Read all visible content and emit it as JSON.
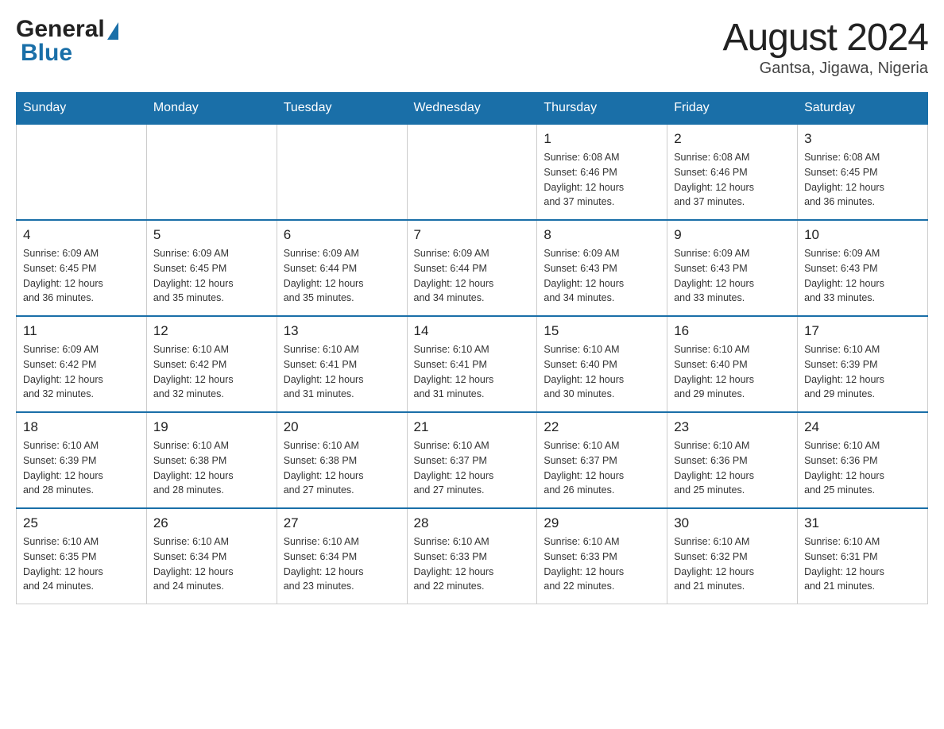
{
  "header": {
    "logo_general": "General",
    "logo_blue": "Blue",
    "title": "August 2024",
    "subtitle": "Gantsa, Jigawa, Nigeria"
  },
  "weekdays": [
    "Sunday",
    "Monday",
    "Tuesday",
    "Wednesday",
    "Thursday",
    "Friday",
    "Saturday"
  ],
  "weeks": [
    [
      {
        "day": "",
        "info": ""
      },
      {
        "day": "",
        "info": ""
      },
      {
        "day": "",
        "info": ""
      },
      {
        "day": "",
        "info": ""
      },
      {
        "day": "1",
        "info": "Sunrise: 6:08 AM\nSunset: 6:46 PM\nDaylight: 12 hours\nand 37 minutes."
      },
      {
        "day": "2",
        "info": "Sunrise: 6:08 AM\nSunset: 6:46 PM\nDaylight: 12 hours\nand 37 minutes."
      },
      {
        "day": "3",
        "info": "Sunrise: 6:08 AM\nSunset: 6:45 PM\nDaylight: 12 hours\nand 36 minutes."
      }
    ],
    [
      {
        "day": "4",
        "info": "Sunrise: 6:09 AM\nSunset: 6:45 PM\nDaylight: 12 hours\nand 36 minutes."
      },
      {
        "day": "5",
        "info": "Sunrise: 6:09 AM\nSunset: 6:45 PM\nDaylight: 12 hours\nand 35 minutes."
      },
      {
        "day": "6",
        "info": "Sunrise: 6:09 AM\nSunset: 6:44 PM\nDaylight: 12 hours\nand 35 minutes."
      },
      {
        "day": "7",
        "info": "Sunrise: 6:09 AM\nSunset: 6:44 PM\nDaylight: 12 hours\nand 34 minutes."
      },
      {
        "day": "8",
        "info": "Sunrise: 6:09 AM\nSunset: 6:43 PM\nDaylight: 12 hours\nand 34 minutes."
      },
      {
        "day": "9",
        "info": "Sunrise: 6:09 AM\nSunset: 6:43 PM\nDaylight: 12 hours\nand 33 minutes."
      },
      {
        "day": "10",
        "info": "Sunrise: 6:09 AM\nSunset: 6:43 PM\nDaylight: 12 hours\nand 33 minutes."
      }
    ],
    [
      {
        "day": "11",
        "info": "Sunrise: 6:09 AM\nSunset: 6:42 PM\nDaylight: 12 hours\nand 32 minutes."
      },
      {
        "day": "12",
        "info": "Sunrise: 6:10 AM\nSunset: 6:42 PM\nDaylight: 12 hours\nand 32 minutes."
      },
      {
        "day": "13",
        "info": "Sunrise: 6:10 AM\nSunset: 6:41 PM\nDaylight: 12 hours\nand 31 minutes."
      },
      {
        "day": "14",
        "info": "Sunrise: 6:10 AM\nSunset: 6:41 PM\nDaylight: 12 hours\nand 31 minutes."
      },
      {
        "day": "15",
        "info": "Sunrise: 6:10 AM\nSunset: 6:40 PM\nDaylight: 12 hours\nand 30 minutes."
      },
      {
        "day": "16",
        "info": "Sunrise: 6:10 AM\nSunset: 6:40 PM\nDaylight: 12 hours\nand 29 minutes."
      },
      {
        "day": "17",
        "info": "Sunrise: 6:10 AM\nSunset: 6:39 PM\nDaylight: 12 hours\nand 29 minutes."
      }
    ],
    [
      {
        "day": "18",
        "info": "Sunrise: 6:10 AM\nSunset: 6:39 PM\nDaylight: 12 hours\nand 28 minutes."
      },
      {
        "day": "19",
        "info": "Sunrise: 6:10 AM\nSunset: 6:38 PM\nDaylight: 12 hours\nand 28 minutes."
      },
      {
        "day": "20",
        "info": "Sunrise: 6:10 AM\nSunset: 6:38 PM\nDaylight: 12 hours\nand 27 minutes."
      },
      {
        "day": "21",
        "info": "Sunrise: 6:10 AM\nSunset: 6:37 PM\nDaylight: 12 hours\nand 27 minutes."
      },
      {
        "day": "22",
        "info": "Sunrise: 6:10 AM\nSunset: 6:37 PM\nDaylight: 12 hours\nand 26 minutes."
      },
      {
        "day": "23",
        "info": "Sunrise: 6:10 AM\nSunset: 6:36 PM\nDaylight: 12 hours\nand 25 minutes."
      },
      {
        "day": "24",
        "info": "Sunrise: 6:10 AM\nSunset: 6:36 PM\nDaylight: 12 hours\nand 25 minutes."
      }
    ],
    [
      {
        "day": "25",
        "info": "Sunrise: 6:10 AM\nSunset: 6:35 PM\nDaylight: 12 hours\nand 24 minutes."
      },
      {
        "day": "26",
        "info": "Sunrise: 6:10 AM\nSunset: 6:34 PM\nDaylight: 12 hours\nand 24 minutes."
      },
      {
        "day": "27",
        "info": "Sunrise: 6:10 AM\nSunset: 6:34 PM\nDaylight: 12 hours\nand 23 minutes."
      },
      {
        "day": "28",
        "info": "Sunrise: 6:10 AM\nSunset: 6:33 PM\nDaylight: 12 hours\nand 22 minutes."
      },
      {
        "day": "29",
        "info": "Sunrise: 6:10 AM\nSunset: 6:33 PM\nDaylight: 12 hours\nand 22 minutes."
      },
      {
        "day": "30",
        "info": "Sunrise: 6:10 AM\nSunset: 6:32 PM\nDaylight: 12 hours\nand 21 minutes."
      },
      {
        "day": "31",
        "info": "Sunrise: 6:10 AM\nSunset: 6:31 PM\nDaylight: 12 hours\nand 21 minutes."
      }
    ]
  ],
  "colors": {
    "header_bg": "#1a6fa8",
    "header_text": "#ffffff",
    "border": "#cccccc",
    "day_number_color": "#222222",
    "info_color": "#333333"
  }
}
